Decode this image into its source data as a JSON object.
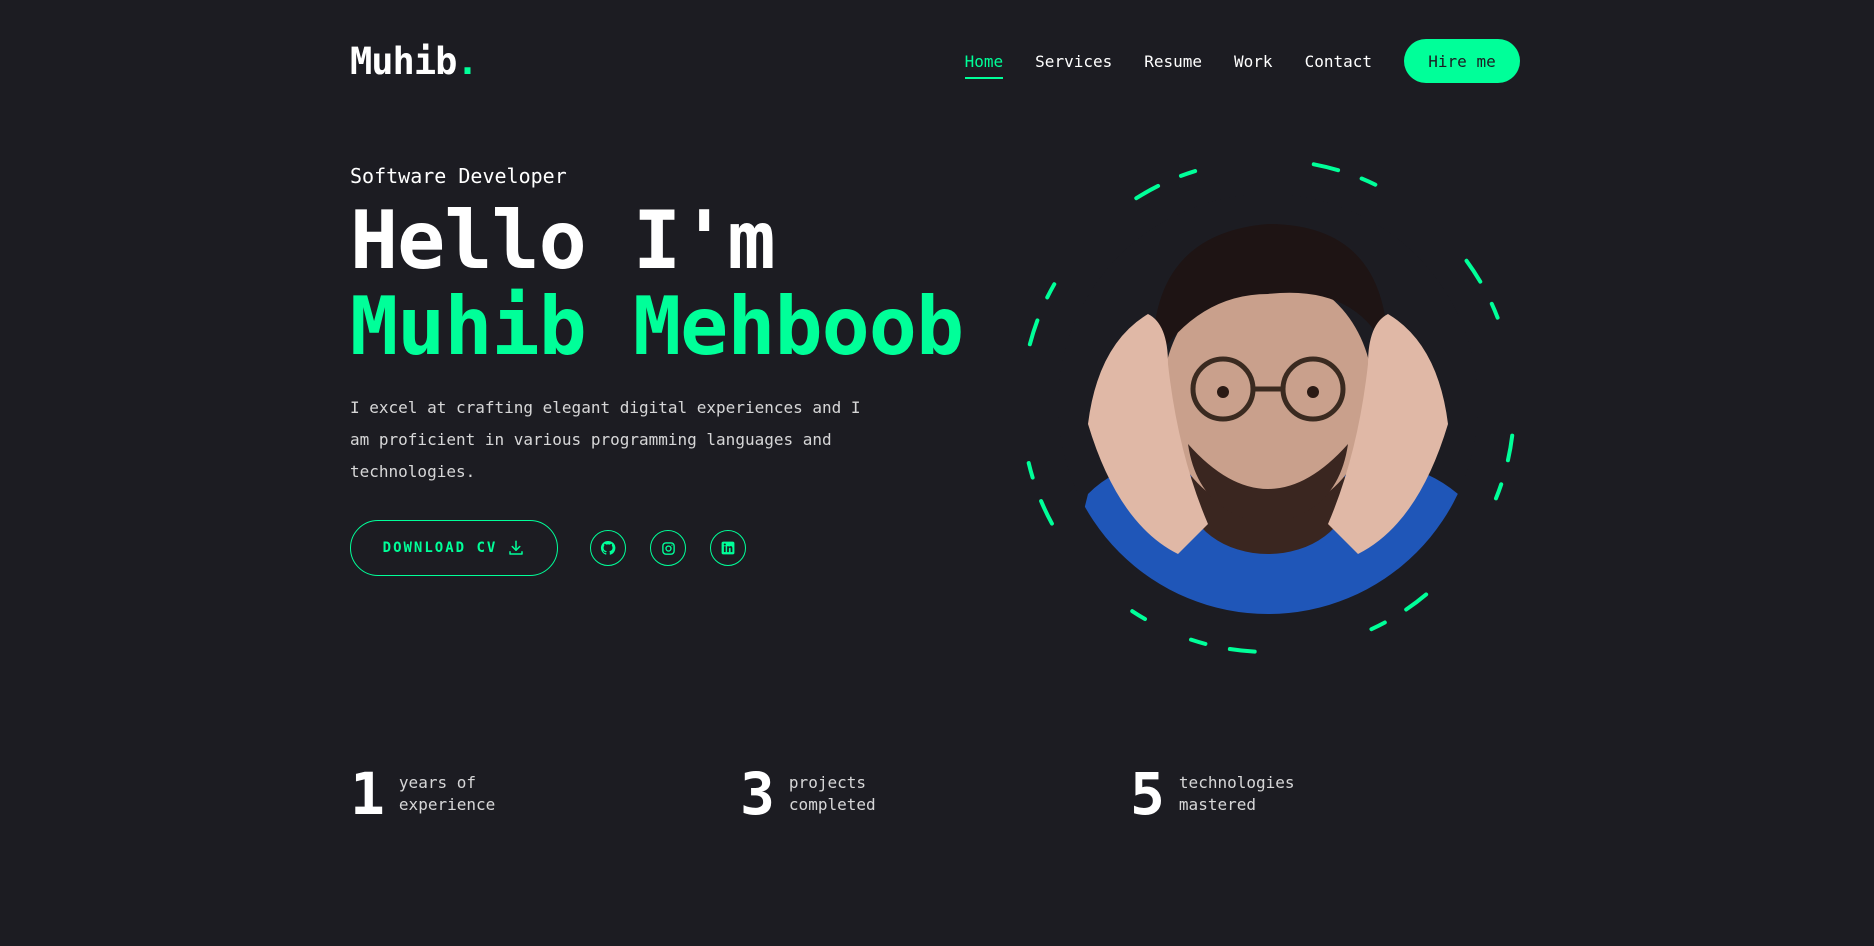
{
  "header": {
    "logo_text": "Muhib",
    "logo_dot": ".",
    "nav": [
      "Home",
      "Services",
      "Resume",
      "Work",
      "Contact"
    ],
    "active_nav": "Home",
    "hire_label": "Hire me"
  },
  "hero": {
    "role": "Software Developer",
    "greeting": "Hello I'm",
    "name": "Muhib Mehboob",
    "description": "I excel at crafting elegant digital experiences and I am proficient in various programming languages and technologies.",
    "download_label": "DOWNLOAD CV",
    "socials": [
      {
        "icon": "github-icon"
      },
      {
        "icon": "instagram-icon"
      },
      {
        "icon": "linkedin-icon"
      }
    ]
  },
  "stats": [
    {
      "number": "1",
      "label": "years of experience"
    },
    {
      "number": "3",
      "label": "projects completed"
    },
    {
      "number": "5",
      "label": "technologies mastered"
    }
  ],
  "colors": {
    "background": "#1c1c22",
    "accent": "#00ff99",
    "text": "#ffffff"
  }
}
